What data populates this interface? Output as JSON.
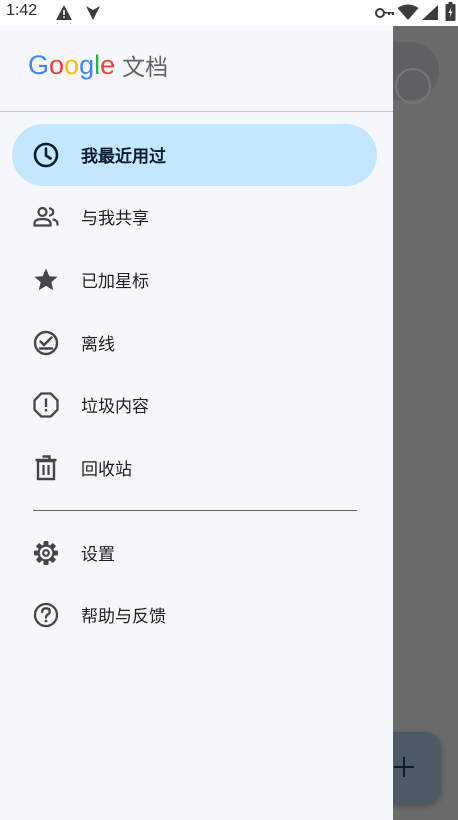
{
  "status_bar": {
    "time": "1:42"
  },
  "app": {
    "logo_google": [
      "G",
      "o",
      "o",
      "g",
      "l",
      "e"
    ],
    "logo_product": "文档"
  },
  "nav": {
    "items": [
      {
        "label": "我最近用过",
        "icon": "clock-icon",
        "active": true
      },
      {
        "label": "与我共享",
        "icon": "people-icon"
      },
      {
        "label": "已加星标",
        "icon": "star-icon"
      },
      {
        "label": "离线",
        "icon": "offline-check-icon"
      },
      {
        "label": "垃圾内容",
        "icon": "spam-icon"
      },
      {
        "label": "回收站",
        "icon": "trash-icon"
      }
    ],
    "secondary": [
      {
        "label": "设置",
        "icon": "gear-icon"
      },
      {
        "label": "帮助与反馈",
        "icon": "help-icon"
      }
    ]
  },
  "colors": {
    "active_bg": "#c2e7ff",
    "drawer_bg": "#f5f7fd",
    "scrim": "#6b6b6b",
    "google_blue": "#4285f4",
    "google_red": "#ea4335",
    "google_yellow": "#fbbc05",
    "google_green": "#34a853"
  }
}
